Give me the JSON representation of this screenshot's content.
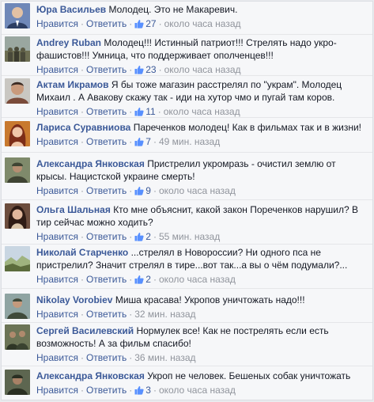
{
  "labels": {
    "like": "Нравится",
    "reply": "Ответить",
    "dot": "·"
  },
  "comments": [
    {
      "author": "Юра Васильев",
      "text": "Молодец. Это не Макаревич.",
      "likes": "27",
      "time": "около часа назад"
    },
    {
      "author": "Andrey Ruban",
      "text": "Молодец!!! Истинный патриот!!! Стрелять надо укро-фашистов!!! Умница, что поддерживает ополченцев!!!",
      "likes": "23",
      "time": "около часа назад"
    },
    {
      "author": "Актам Икрамов",
      "text": "Я бы тоже магазин расстрелял по \"украм\". Молодец Михаил . А Авакову скажу так - иди на хутор чмо и пугай там коров.",
      "likes": "11",
      "time": "около часа назад"
    },
    {
      "author": "Лариса Суравниова",
      "text": "Пареченков молодец! Как в фильмах так и в жизни!",
      "likes": "7",
      "time": "49 мин. назад"
    },
    {
      "author": "Александра Янковская",
      "text": "Пристрелил укромразь - очистил землю от крысы. Нацистской украине смерть!",
      "likes": "9",
      "time": "около часа назад"
    },
    {
      "author": "Ольга Шальная",
      "text": "Кто мне объяснит, какой закон Пореченков нарушил? В тир сейчас можно ходить?",
      "likes": "2",
      "time": "55 мин. назад"
    },
    {
      "author": "Николай Старченко",
      "text": "...стрелял в Новороссии? Ни одного пса не пристрелил? Значит стрелял в тире...вот так...а вы о чём подумали?...",
      "likes": "2",
      "time": "около часа назад"
    },
    {
      "author": "Nikolay Vorobiev",
      "text": "Миша красава! Укропов уничтожать надо!!!",
      "likes": "",
      "time": "32 мин. назад"
    },
    {
      "author": "Сергей Василевский",
      "text": "Нормулек все! Как не пострелять если есть возможность! А за фильм спасибо!",
      "likes": "",
      "time": "36 мин. назад"
    },
    {
      "author": "Александра Янковская",
      "text": "Укроп не человек. Бешеных собак уничтожать",
      "likes": "3",
      "time": "около часа назад"
    }
  ],
  "avatars": [
    {
      "icon": "avatar-man-suit-icon",
      "bg": "#6f88b8",
      "fg": "#2c3e63"
    },
    {
      "icon": "avatar-crowd-icon",
      "bg": "#9aa7a0",
      "fg": "#5b5a44"
    },
    {
      "icon": "avatar-man-icon",
      "bg": "#c9c7c2",
      "fg": "#7a4b3a"
    },
    {
      "icon": "avatar-woman-red-icon",
      "bg": "#c8792e",
      "fg": "#7d2d18"
    },
    {
      "icon": "avatar-soldier-icon",
      "bg": "#7f8a6b",
      "fg": "#3f4433"
    },
    {
      "icon": "avatar-woman-icon",
      "bg": "#6c4d3d",
      "fg": "#e0b79c"
    },
    {
      "icon": "avatar-landscape-icon",
      "bg": "#9fb37f",
      "fg": "#5c6c3d"
    },
    {
      "icon": "avatar-man-outdoors-icon",
      "bg": "#8fa4a2",
      "fg": "#3f4a3a"
    },
    {
      "icon": "avatar-soldier-group-icon",
      "bg": "#6c7456",
      "fg": "#2f3626"
    },
    {
      "icon": "avatar-soldier-icon",
      "bg": "#5d6650",
      "fg": "#2a2f22"
    }
  ],
  "colors": {
    "link": "#3b5998",
    "meta": "#90949c",
    "text": "#141823"
  }
}
